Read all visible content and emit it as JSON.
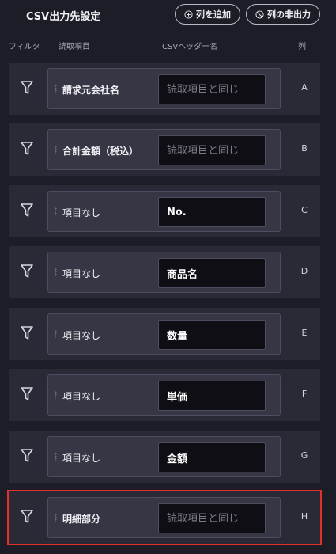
{
  "header": {
    "title": "CSV出力先設定",
    "add_column_label": "列を追加",
    "hide_column_label": "列の非出力"
  },
  "columns": {
    "filter": "フィルタ",
    "source_item": "読取項目",
    "csv_header": "CSVヘッダー名",
    "column": "列"
  },
  "placeholder": "読取項目と同じ",
  "rows": [
    {
      "source": "請求元会社名",
      "header_value": "",
      "column": "A",
      "highlighted": false
    },
    {
      "source": "合計金額（税込）",
      "header_value": "",
      "column": "B",
      "highlighted": false
    },
    {
      "source": "項目なし",
      "header_value": "No.",
      "column": "C",
      "highlighted": false
    },
    {
      "source": "項目なし",
      "header_value": "商品名",
      "column": "D",
      "highlighted": false
    },
    {
      "source": "項目なし",
      "header_value": "数量",
      "column": "E",
      "highlighted": false
    },
    {
      "source": "項目なし",
      "header_value": "単価",
      "column": "F",
      "highlighted": false
    },
    {
      "source": "項目なし",
      "header_value": "金額",
      "column": "G",
      "highlighted": false
    },
    {
      "source": "明細部分",
      "header_value": "",
      "column": "H",
      "highlighted": true
    }
  ],
  "icons": {
    "filter": "filter-funnel-icon",
    "add": "plus-circle-icon",
    "hide": "ban-circle-icon",
    "grip": "drag-handle-icon"
  },
  "colors": {
    "background": "#1d1d27",
    "row": "#2a2a37",
    "input": "#0e0e14",
    "highlight": "#e3302a"
  }
}
